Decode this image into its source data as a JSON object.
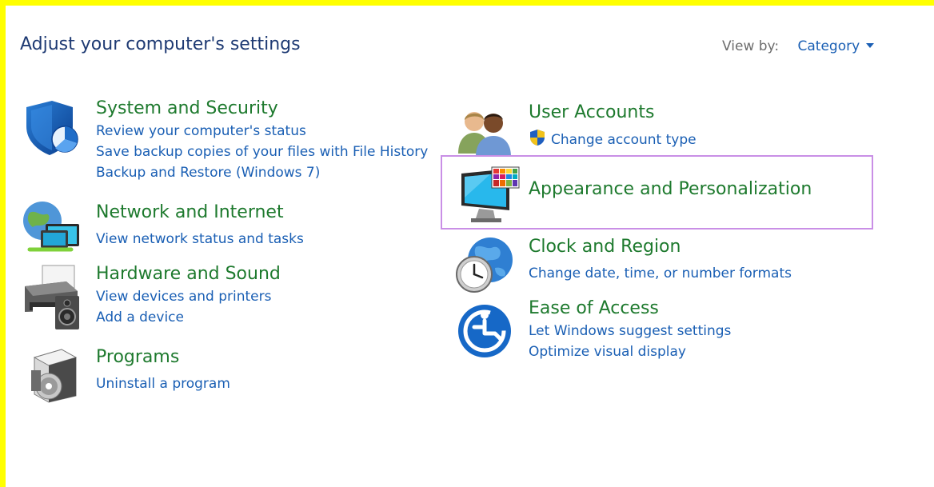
{
  "header": {
    "title": "Adjust your computer's settings",
    "view_by_label": "View by:",
    "view_by_value": "Category"
  },
  "categories": {
    "system": {
      "title": "System and Security",
      "links": [
        "Review your computer's status",
        "Save backup copies of your files with File History",
        "Backup and Restore (Windows 7)"
      ],
      "icon": "shield-icon"
    },
    "network": {
      "title": "Network and Internet",
      "links": [
        "View network status and tasks"
      ],
      "icon": "network-globe-icon"
    },
    "hardware": {
      "title": "Hardware and Sound",
      "links": [
        "View devices and printers",
        "Add a device"
      ],
      "icon": "printer-speaker-icon"
    },
    "programs": {
      "title": "Programs",
      "links": [
        "Uninstall a program"
      ],
      "icon": "programs-disc-icon"
    },
    "users": {
      "title": "User Accounts",
      "links": [
        "Change account type"
      ],
      "icon": "users-icon"
    },
    "appearance": {
      "title": "Appearance and Personalization",
      "links": [],
      "icon": "monitor-palette-icon"
    },
    "clock": {
      "title": "Clock and Region",
      "links": [
        "Change date, time, or number formats"
      ],
      "icon": "clock-globe-icon"
    },
    "ease": {
      "title": "Ease of Access",
      "links": [
        "Let Windows suggest settings",
        "Optimize visual display"
      ],
      "icon": "ease-of-access-icon"
    }
  },
  "colors": {
    "frame": "#ffff00",
    "category_title": "#1e7a2e",
    "link": "#1a5fb4",
    "highlight_border": "#c98fe6"
  }
}
